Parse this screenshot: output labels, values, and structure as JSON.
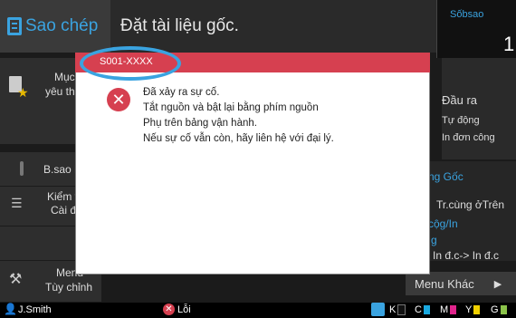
{
  "header": {
    "mode_label": "Sao chép",
    "message": "Đặt tài liệu gốc.",
    "copies_label": "Sốbsao",
    "copies_value": "1"
  },
  "left_menu": {
    "favorites": [
      "Mục",
      "yêu thích"
    ],
    "bsao": "B.sao Mẫu",
    "check": [
      "Kiểm tra",
      "Cài đặt"
    ],
    "custom": [
      "Menu",
      "Tùy chỉnh"
    ]
  },
  "right_panel": {
    "output_label": "Đầu ra",
    "output_auto": "Tự động",
    "output_single": "In đơn công",
    "original_size": "ng Gốc",
    "same_dir": "Tr.cùng ởTrên",
    "duplex": "cộg/In",
    "g": "g",
    "duplex_mode": "In đ.c-> In đ.c"
  },
  "menu_khac": "Menu Khác",
  "status_bar": {
    "user": "J.Smith",
    "error": "Lỗi",
    "inks": [
      "K",
      "C",
      "M",
      "Y",
      "G"
    ]
  },
  "dialog": {
    "code": "S001-XXXX",
    "lines": [
      "Đã xảy ra sự cố.",
      "Tắt nguồn và bật lại bằng phím nguồn",
      "Phụ trên bảng vận hành.",
      "Nếu sự cố vẫn còn, hãy liên hệ với đại lý."
    ]
  },
  "colors": {
    "accent": "#3aa3e0",
    "error": "#d64050"
  }
}
